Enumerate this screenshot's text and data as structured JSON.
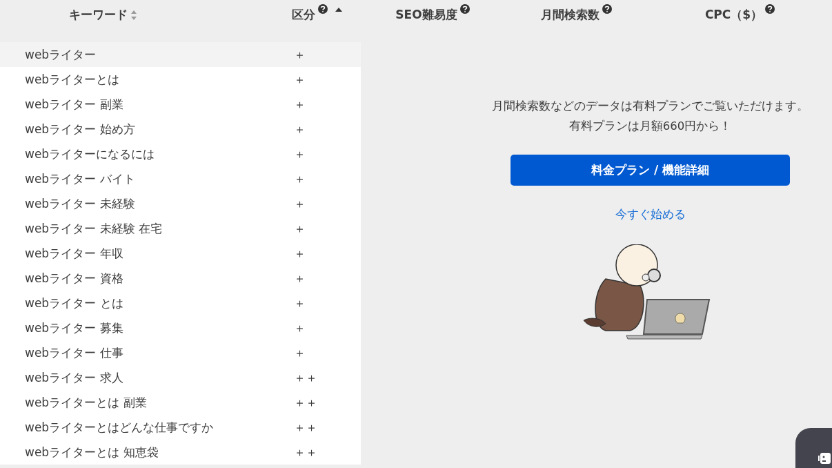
{
  "table": {
    "columns": [
      {
        "label": "キーワード",
        "sortable": true,
        "sorted": false,
        "help": false
      },
      {
        "label": "区分",
        "sortable": true,
        "sorted": true,
        "help": true
      },
      {
        "label": "SEO難易度",
        "sortable": false,
        "help": true
      },
      {
        "label": "月間検索数",
        "sortable": false,
        "help": true
      },
      {
        "label": "CPC（$）",
        "sortable": false,
        "help": true
      }
    ],
    "rows": [
      {
        "keyword": "webライター",
        "category": "＋",
        "selected": true
      },
      {
        "keyword": "webライターとは",
        "category": "＋",
        "selected": false
      },
      {
        "keyword": "webライター 副業",
        "category": "＋",
        "selected": false
      },
      {
        "keyword": "webライター 始め方",
        "category": "＋",
        "selected": false
      },
      {
        "keyword": "webライターになるには",
        "category": "＋",
        "selected": false
      },
      {
        "keyword": "webライター バイト",
        "category": "＋",
        "selected": false
      },
      {
        "keyword": "webライター 未経験",
        "category": "＋",
        "selected": false
      },
      {
        "keyword": "webライター 未経験 在宅",
        "category": "＋",
        "selected": false
      },
      {
        "keyword": "webライター 年収",
        "category": "＋",
        "selected": false
      },
      {
        "keyword": "webライター 資格",
        "category": "＋",
        "selected": false
      },
      {
        "keyword": "webライター とは",
        "category": "＋",
        "selected": false
      },
      {
        "keyword": "webライター 募集",
        "category": "＋",
        "selected": false
      },
      {
        "keyword": "webライター 仕事",
        "category": "＋",
        "selected": false
      },
      {
        "keyword": "webライター 求人",
        "category": "＋＋",
        "selected": false
      },
      {
        "keyword": "webライターとは 副業",
        "category": "＋＋",
        "selected": false
      },
      {
        "keyword": "webライターとはどんな仕事ですか",
        "category": "＋＋",
        "selected": false
      },
      {
        "keyword": "webライターとは 知恵袋",
        "category": "＋＋",
        "selected": false
      }
    ]
  },
  "upsell": {
    "message_lines": [
      "月間検索数などのデータは有料プランでご覧いただけます。",
      "有料プランは月額660円から！"
    ],
    "button": "料金プラン / 機能詳細",
    "link": "今すぐ始める"
  }
}
